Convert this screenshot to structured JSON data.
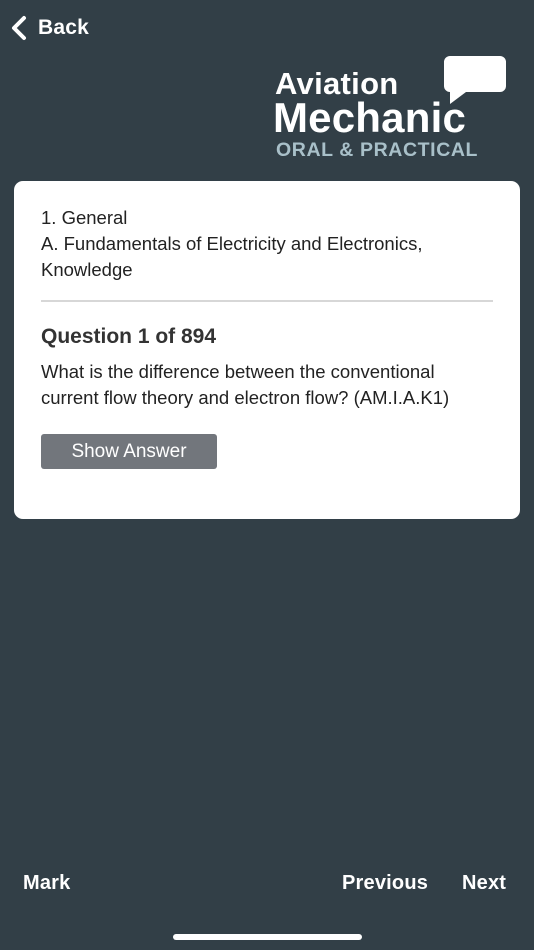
{
  "nav": {
    "back_label": "Back"
  },
  "logo": {
    "line1": "Aviation",
    "line2": "Mechanic",
    "line3": "ORAL & PRACTICAL"
  },
  "card": {
    "section_title": "1. General",
    "subsection_title": "A. Fundamentals of Electricity and Electronics, Knowledge",
    "question_count": "Question 1 of 894",
    "question_text": "What is the difference between the conventional current flow theory and electron flow? (AM.I.A.K1)",
    "show_answer_label": "Show Answer"
  },
  "bottom_bar": {
    "mark_label": "Mark",
    "previous_label": "Previous",
    "next_label": "Next"
  },
  "icons": {
    "back": "chevron-left-icon",
    "logo_bubble": "speech-bubble-icon"
  },
  "colors": {
    "background": "#323f47",
    "card": "#ffffff",
    "button": "#72767c",
    "logo_accent": "#a9c0c9",
    "text": "#222222"
  }
}
